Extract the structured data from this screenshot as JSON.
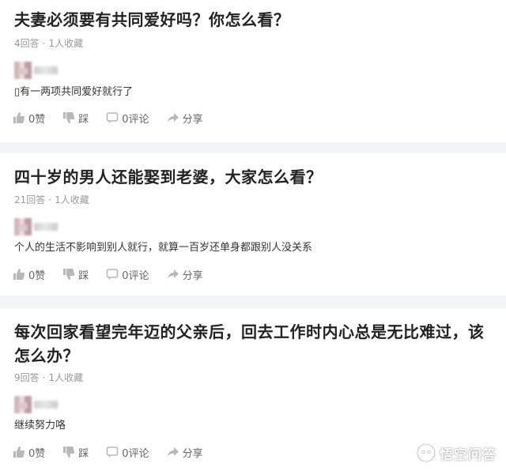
{
  "questions": [
    {
      "title": "夫妻必须要有共同爱好吗？你怎么看？",
      "answers_count": "4回答",
      "favorites": "1人收藏",
      "answer_text": "▯有一两项共同爱好就行了",
      "like": "0赞",
      "dislike": "踩",
      "comments": "0评论",
      "share": "分享"
    },
    {
      "title": "四十岁的男人还能娶到老婆，大家怎么看？",
      "answers_count": "21回答",
      "favorites": "1人收藏",
      "answer_text": "个人的生活不影响到别人就行，就算一百岁还单身都跟别人没关系",
      "like": "0赞",
      "dislike": "踩",
      "comments": "0评论",
      "share": "分享"
    },
    {
      "title": "每次回家看望完年迈的父亲后，回去工作时内心总是无比难过，该怎么办？",
      "answers_count": "9回答",
      "favorites": "1人收藏",
      "answer_text": "继续努力咯",
      "like": "0赞",
      "dislike": "踩",
      "comments": "0评论",
      "share": "分享"
    }
  ],
  "meta_separator": "·",
  "watermark": "悟空问答",
  "colors": {
    "title": "#222222",
    "meta": "#999999",
    "separator_band": "#f4f5f6",
    "action": "#666666"
  }
}
